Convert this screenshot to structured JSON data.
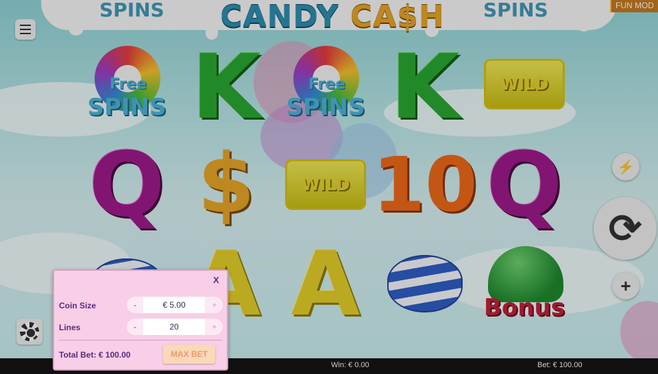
{
  "header": {
    "logo_candy": "CANDY",
    "logo_cash": "CA$H",
    "side_left": "SPINS",
    "side_right": "SPINS",
    "fun_mode": "FUN MOD"
  },
  "reels": {
    "free_label_top": "Free",
    "free_label_bottom": "SPINS",
    "wild_label": "WILD",
    "bonus_label": "Bonus",
    "k": "K",
    "q": "Q",
    "a": "A",
    "ten": "10",
    "dollar": "$"
  },
  "controls": {
    "menu_icon": "hamburger-menu-icon",
    "turbo_icon": "lightning-icon",
    "spin_icon": "refresh-spin-icon",
    "plus_icon": "plus-icon",
    "chip_icon": "casino-chip-icon",
    "turbo_glyph": "⚡",
    "spin_glyph": "⟳",
    "plus_glyph": "+"
  },
  "bet_panel": {
    "close": "X",
    "coin_size_label": "Coin Size",
    "coin_size_value": "€ 5.00",
    "lines_label": "Lines",
    "lines_value": "20",
    "minus": "-",
    "plus": "+",
    "total_bet": "Total Bet: € 100.00",
    "max_bet": "MAX BET"
  },
  "status_bar": {
    "win": "Win: € 0.00",
    "bet": "Bet: € 100.00"
  },
  "colors": {
    "panel_bg": "#f8cfe7",
    "label": "#5a2a7c",
    "max_bet_text": "#ec9a70",
    "status_bg": "#111111"
  }
}
